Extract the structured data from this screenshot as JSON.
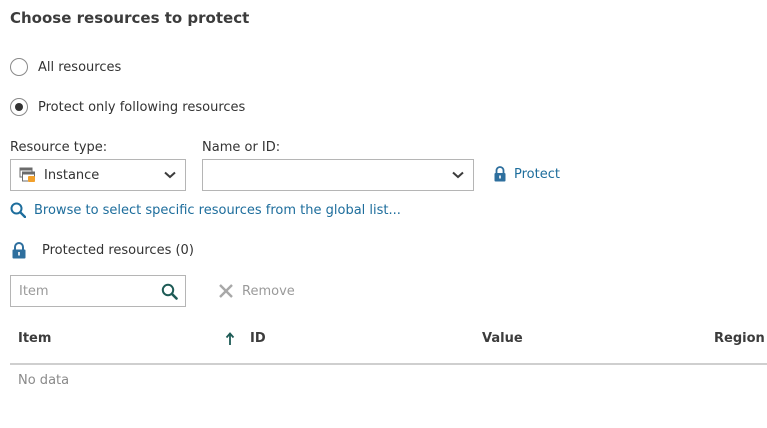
{
  "section_title": "Choose resources to protect",
  "options": {
    "all_resources": {
      "label": "All resources",
      "selected": false
    },
    "following_resources": {
      "label": "Protect only following resources",
      "selected": true
    }
  },
  "resource_type": {
    "label": "Resource type:",
    "selected": "Instance",
    "icon": "instance-icon"
  },
  "name_or_id": {
    "label": "Name or ID:",
    "value": ""
  },
  "protect_label": "Protect",
  "browse_label": "Browse to select specific resources from the global list...",
  "protected": {
    "label": "Protected resources (0)"
  },
  "filter": {
    "placeholder": "Item"
  },
  "remove_label": "Remove",
  "table": {
    "columns": [
      "Item",
      "ID",
      "Value",
      "Region"
    ],
    "empty_text": "No data"
  },
  "colors": {
    "link": "#1d6d9c",
    "accent_icon": "#2e6f9e",
    "search_icon": "#1e5b56",
    "disabled": "#9a9a9a"
  }
}
